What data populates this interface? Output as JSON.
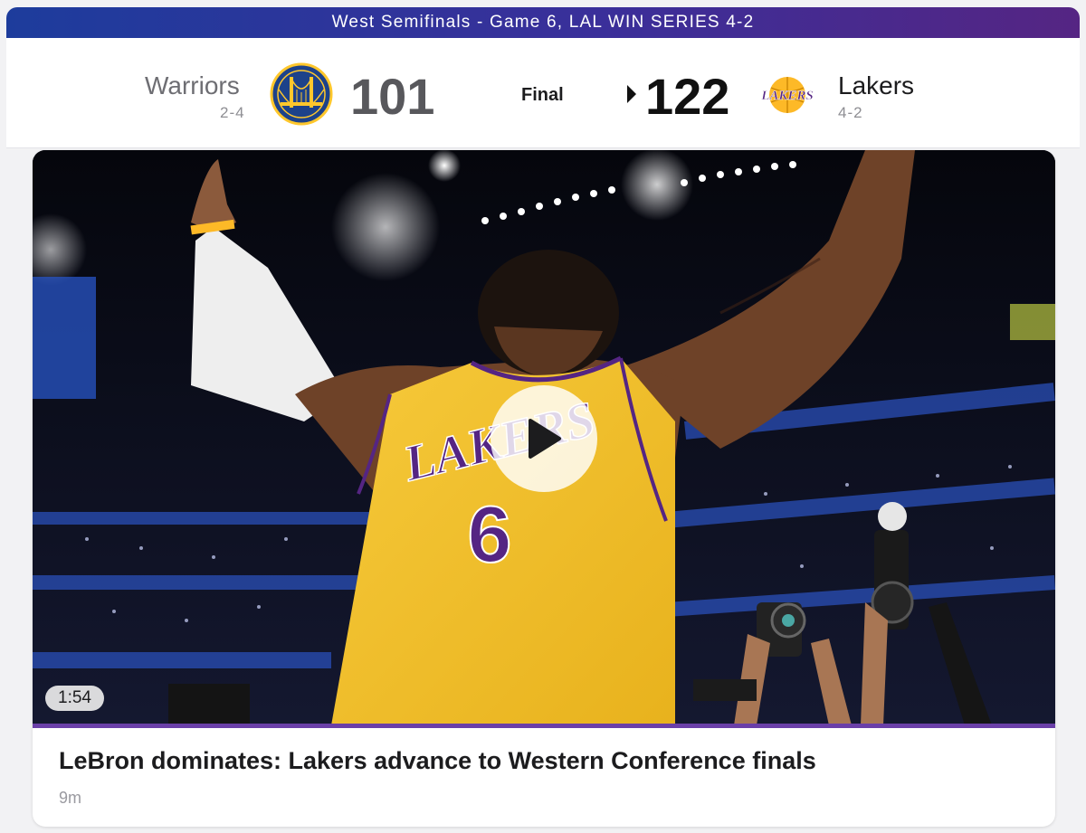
{
  "banner": {
    "text": "West Semifinals - Game 6, LAL WIN SERIES 4-2"
  },
  "game": {
    "status": "Final",
    "away": {
      "name": "Warriors",
      "record": "2-4",
      "score": "101",
      "logo_icon": "warriors-logo-icon",
      "color": "#1D428A"
    },
    "home": {
      "name": "Lakers",
      "record": "4-2",
      "score": "122",
      "logo_icon": "lakers-logo-icon",
      "color": "#552583",
      "winner": true
    }
  },
  "story": {
    "duration": "1:54",
    "headline": "LeBron dominates: Lakers advance to Western Conference finals",
    "age": "9m",
    "jersey_text": "LAKERS",
    "jersey_number": "6"
  },
  "colors": {
    "accent_purple": "#552583",
    "lakers_gold": "#FDB927",
    "warriors_blue": "#1D428A",
    "warriors_gold": "#FFC72C"
  }
}
